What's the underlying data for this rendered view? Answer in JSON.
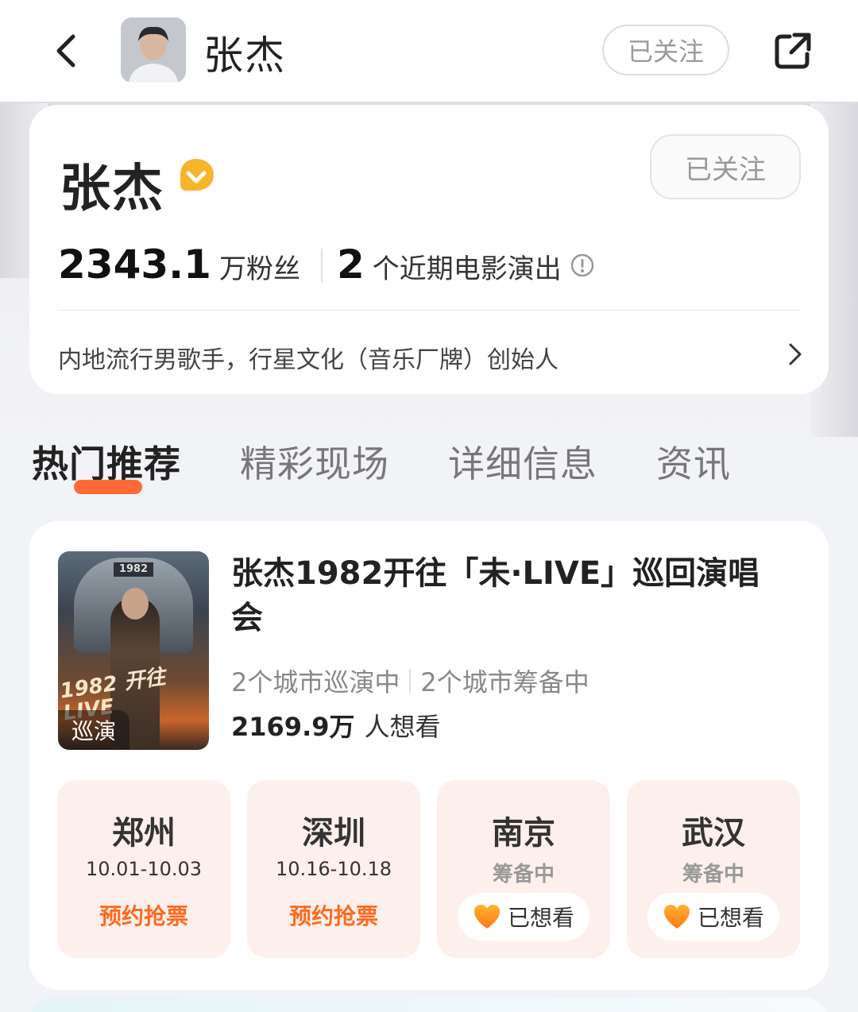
{
  "header": {
    "title": "张杰",
    "follow_label": "已关注"
  },
  "profile": {
    "name": "张杰",
    "follow_label": "已关注",
    "fans_count": "2343.1",
    "fans_unit": "万粉丝",
    "shows_count": "2",
    "shows_label": "个近期电影演出",
    "bio": "内地流行男歌手，行星文化（音乐厂牌）创始人"
  },
  "tabs": [
    {
      "label": "热门推荐",
      "active": true
    },
    {
      "label": "精彩现场",
      "active": false
    },
    {
      "label": "详细信息",
      "active": false
    },
    {
      "label": "资讯",
      "active": false
    }
  ],
  "event": {
    "poster_tag": "巡演",
    "poster_plate": "1982",
    "poster_scrawl": "1982 开往 LIVE",
    "title": "张杰1982开往「未·LIVE」巡回演唱会",
    "touring": "2个城市巡演中",
    "preparing": "2个城市筹备中",
    "want_count": "2169.9万",
    "want_label": "人想看",
    "cities": [
      {
        "name": "郑州",
        "date": "10.01-10.03",
        "cta": "预约抢票"
      },
      {
        "name": "深圳",
        "date": "10.16-10.18",
        "cta": "预约抢票"
      },
      {
        "name": "南京",
        "status": "筹备中",
        "want_button": "已想看"
      },
      {
        "name": "武汉",
        "status": "筹备中",
        "want_button": "已想看"
      }
    ]
  },
  "colors": {
    "accent": "#ff6a1f",
    "verify": "#f7b52c",
    "city_bg": "#fdf0ec"
  }
}
